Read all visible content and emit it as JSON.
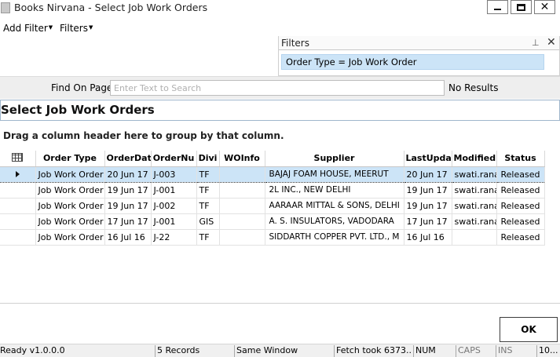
{
  "window": {
    "title": "Books Nirvana - Select Job Work Orders",
    "minimize_glyph": "",
    "close_glyph": "✕"
  },
  "menu": {
    "add_filter": "Add Filter",
    "filters": "Filters"
  },
  "filters_panel": {
    "title": "Filters",
    "pin_glyph": "📌",
    "close_glyph": "✕",
    "items": [
      "Order Type = Job Work Order"
    ]
  },
  "find": {
    "label": "Find On Page",
    "placeholder": "Enter Text to Search",
    "value": "",
    "result": "No Results"
  },
  "section": {
    "title": "Select Job Work Orders",
    "group_hint": "Drag a column header here to group by that column."
  },
  "grid": {
    "columns": [
      "Order Type",
      "OrderDat",
      "OrderNu",
      "Divi",
      "WOInfo",
      "Supplier",
      "LastUpdat",
      "Modified",
      "Status"
    ],
    "selected_row": 0,
    "rows": [
      [
        "Job Work Order",
        "20 Jun 17",
        "J-003",
        "TF",
        "",
        "BAJAJ FOAM HOUSE, MEERUT",
        "20 Jun 17",
        "swati.rana",
        "Released"
      ],
      [
        "Job Work Order",
        "19 Jun 17",
        "J-001",
        "TF",
        "",
        "2L INC., NEW DELHI",
        "19 Jun 17",
        "swati.rana",
        "Released"
      ],
      [
        "Job Work Order",
        "19 Jun 17",
        "J-002",
        "TF",
        "",
        "AARAAR MITTAL & SONS, DELHI",
        "19 Jun 17",
        "swati.rana",
        "Released"
      ],
      [
        "Job Work Order",
        "17 Jun 17",
        "J-001",
        "GIS",
        "",
        "A. S. INSULATORS, VADODARA",
        "17 Jun 17",
        "swati.rana",
        "Released"
      ],
      [
        "Job Work Order",
        "16 Jul 16",
        "J-22",
        "TF",
        "",
        "SIDDARTH COPPER PVT. LTD., M",
        "16 Jul 16",
        "",
        "Released"
      ]
    ]
  },
  "actions": {
    "ok_label": "OK"
  },
  "statusbar": {
    "ready": "Ready v1.0.0.0",
    "records": "5 Records",
    "window_mode": "Same Window",
    "fetch": "Fetch took 6373...",
    "num": "NUM",
    "caps": "CAPS",
    "ins": "INS",
    "extra": "10..."
  },
  "colors": {
    "selection": "#cce4f7",
    "section_border": "#9fb6cc",
    "findbar_bg": "#eeeeee"
  }
}
